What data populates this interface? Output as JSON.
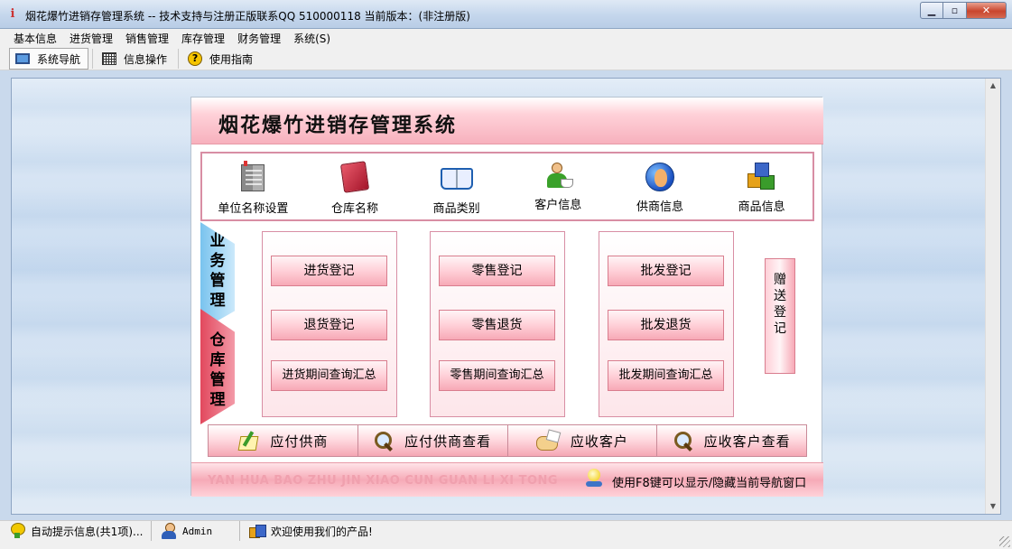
{
  "window": {
    "title": "烟花爆竹进销存管理系统 -- 技术支持与注册正版联系QQ 510000118    当前版本：(非注册版)",
    "minimize": "▁",
    "maximize": "▫",
    "close": "✕"
  },
  "menu": [
    "基本信息",
    "进货管理",
    "销售管理",
    "库存管理",
    "财务管理",
    "系统(S)"
  ],
  "toolbar": {
    "nav": "系统导航",
    "info": "信息操作",
    "guide": "使用指南"
  },
  "panel": {
    "title": "烟花爆竹进销存管理系统",
    "icons": [
      {
        "label": "单位名称设置",
        "icon": "building-icon"
      },
      {
        "label": "仓库名称",
        "icon": "folder-icon"
      },
      {
        "label": "商品类别",
        "icon": "book-icon"
      },
      {
        "label": "客户信息",
        "icon": "person-cup-icon"
      },
      {
        "label": "供商信息",
        "icon": "globe-person-icon"
      },
      {
        "label": "商品信息",
        "icon": "cubes-icon"
      }
    ],
    "side_tabs": {
      "business": "业务管理",
      "warehouse": "仓库管理"
    },
    "groups": {
      "purchase": [
        "进货登记",
        "退货登记",
        "进货期间查询汇总"
      ],
      "retail": [
        "零售登记",
        "零售退货",
        "零售期间查询汇总"
      ],
      "wholesale": [
        "批发登记",
        "批发退货",
        "批发期间查询汇总"
      ]
    },
    "gift": "赠送登记",
    "bottom": [
      "应付供商",
      "应付供商查看",
      "应收客户",
      "应收客户查看"
    ],
    "pinyin": "YAN HUA BAO ZHU JIN XIAO CUN GUAN LI XI TONG",
    "hint": "使用F8键可以显示/隐藏当前导航窗口"
  },
  "status": {
    "tips": "自动提示信息(共1项)...",
    "user": "Admin",
    "welcome": "欢迎使用我们的产品!"
  }
}
